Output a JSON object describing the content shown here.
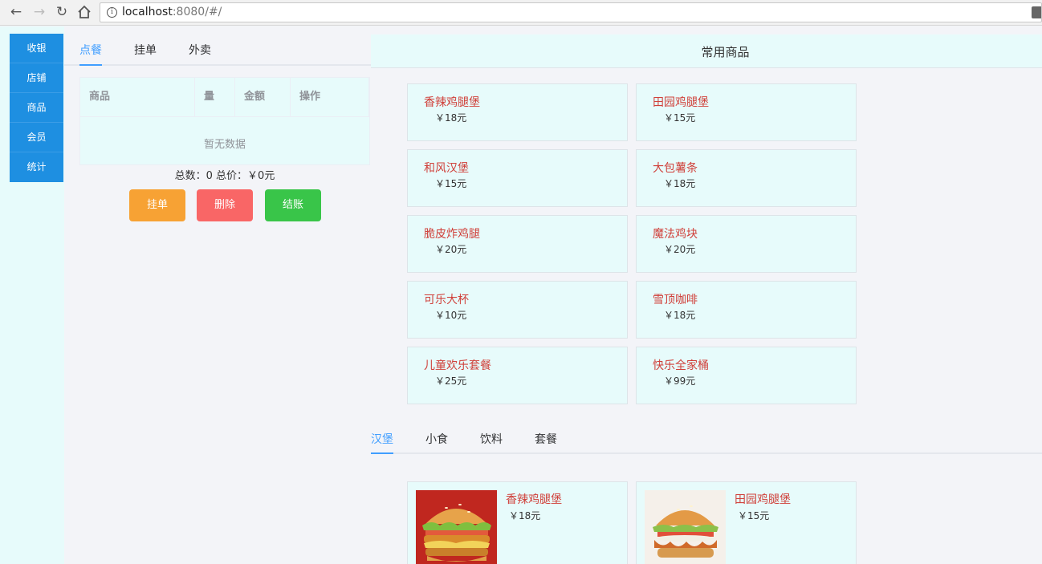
{
  "browser": {
    "url_host": "localhost",
    "url_rest": ":8080/#/"
  },
  "sidebar": {
    "items": [
      {
        "label": "收银"
      },
      {
        "label": "店铺"
      },
      {
        "label": "商品"
      },
      {
        "label": "会员"
      },
      {
        "label": "统计"
      }
    ]
  },
  "order": {
    "tabs": [
      {
        "label": "点餐",
        "active": true
      },
      {
        "label": "挂单",
        "active": false
      },
      {
        "label": "外卖",
        "active": false
      }
    ],
    "columns": [
      "商品",
      "量",
      "金额",
      "操作"
    ],
    "empty_text": "暂无数据",
    "totals": "总数：0 总价：￥0元",
    "buttons": {
      "hang": "挂单",
      "delete": "删除",
      "checkout": "结账"
    }
  },
  "common_goods": {
    "title": "常用商品",
    "items": [
      {
        "name": "香辣鸡腿堡",
        "price": "￥18元"
      },
      {
        "name": "田园鸡腿堡",
        "price": "￥15元"
      },
      {
        "name": "和风汉堡",
        "price": "￥15元"
      },
      {
        "name": "大包薯条",
        "price": "￥18元"
      },
      {
        "name": "脆皮炸鸡腿",
        "price": "￥20元"
      },
      {
        "name": "魔法鸡块",
        "price": "￥20元"
      },
      {
        "name": "可乐大杯",
        "price": "￥10元"
      },
      {
        "name": "雪顶咖啡",
        "price": "￥18元"
      },
      {
        "name": "儿童欢乐套餐",
        "price": "￥25元"
      },
      {
        "name": "快乐全家桶",
        "price": "￥99元"
      }
    ]
  },
  "categories": {
    "tabs": [
      {
        "label": "汉堡",
        "active": true
      },
      {
        "label": "小食",
        "active": false
      },
      {
        "label": "饮料",
        "active": false
      },
      {
        "label": "套餐",
        "active": false
      }
    ],
    "items": [
      {
        "name": "香辣鸡腿堡",
        "price": "￥18元"
      },
      {
        "name": "田园鸡腿堡",
        "price": "￥15元"
      }
    ]
  },
  "colors": {
    "primary": "#409eff",
    "sidebar": "#1e8fe1",
    "hang_button": "#f7a234",
    "delete_button": "#f96666",
    "checkout_button": "#39c549",
    "goods_name": "#d0403a"
  }
}
